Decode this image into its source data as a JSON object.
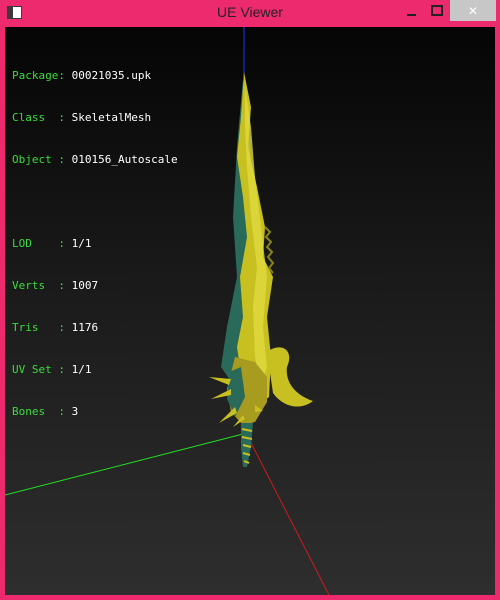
{
  "window": {
    "title": "UE Viewer",
    "frame_color": "#ee2a6e",
    "controls": {
      "minimize_icon": "minimize-icon",
      "maximize_icon": "maximize-icon",
      "close_label": "✕"
    }
  },
  "info": {
    "rows_top": [
      {
        "label": "Package:",
        "value": "00021035.upk"
      },
      {
        "label": "Class  :",
        "value": "SkeletalMesh"
      },
      {
        "label": "Object :",
        "value": "010156_Autoscale"
      }
    ],
    "rows_bottom": [
      {
        "label": "LOD    :",
        "value": "1/1"
      },
      {
        "label": "Verts  :",
        "value": "1007"
      },
      {
        "label": "Tris   :",
        "value": "1176"
      },
      {
        "label": "UV Set :",
        "value": "1/1"
      },
      {
        "label": "Bones  :",
        "value": "3"
      }
    ]
  },
  "colors": {
    "label": "#3cdc3c",
    "value": "#ffffff",
    "axis_x": "#d01a1a",
    "axis_y": "#22e022",
    "axis_z": "#2233ff",
    "blade_yellow": "#c8c020",
    "blade_teal": "#2a6a5a"
  }
}
